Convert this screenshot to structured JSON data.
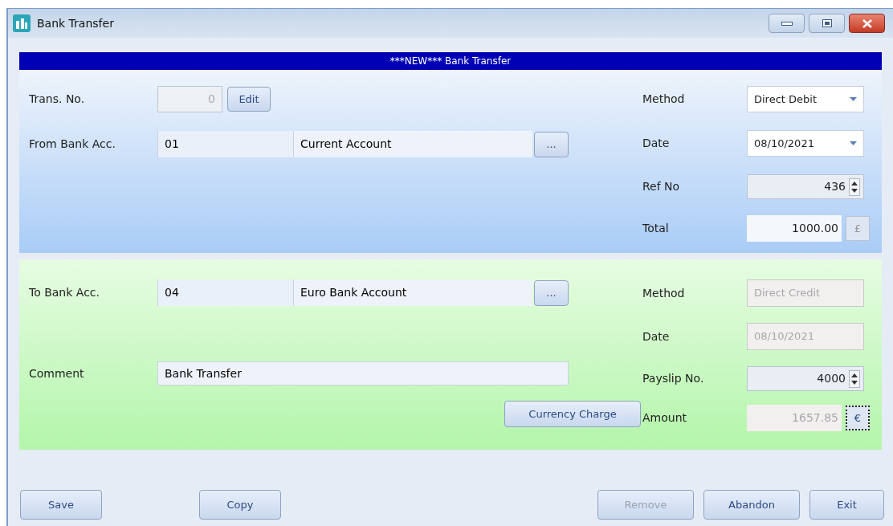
{
  "window": {
    "title": "Bank Transfer"
  },
  "banner": "***NEW*** Bank Transfer",
  "from_section": {
    "trans_no": {
      "label": "Trans. No.",
      "value": "0",
      "disabled": true
    },
    "edit_button": "Edit",
    "account": {
      "label": "From Bank Acc.",
      "code": "01",
      "name": "Current Account",
      "browse": "..."
    },
    "fields": [
      {
        "kind": "select",
        "label": "Method",
        "value": "Direct Debit",
        "disabled": false
      },
      {
        "kind": "select",
        "label": "Date",
        "value": "08/10/2021",
        "disabled": false
      },
      {
        "kind": "spin",
        "label": "Ref No",
        "value": "436",
        "disabled": false
      },
      {
        "kind": "money",
        "label": "Total",
        "value": "1000.00",
        "currency": "£",
        "disabled": false
      }
    ]
  },
  "to_section": {
    "account": {
      "label": "To Bank Acc.",
      "code": "04",
      "name": "Euro Bank Account",
      "browse": "..."
    },
    "comment": {
      "label": "Comment",
      "value": "Bank Transfer"
    },
    "currency_charge_button": "Currency Charge",
    "fields": [
      {
        "kind": "text",
        "label": "Method",
        "value": "Direct Credit",
        "disabled": true
      },
      {
        "kind": "text",
        "label": "Date",
        "value": "08/10/2021",
        "disabled": true
      },
      {
        "kind": "spin",
        "label": "Payslip No.",
        "value": "4000",
        "disabled": false
      },
      {
        "kind": "money",
        "label": "Amount",
        "value": "1657.85",
        "currency": "€",
        "disabled": true
      }
    ]
  },
  "buttons_left": [
    {
      "label": "Save",
      "disabled": false
    },
    {
      "label": "Copy",
      "disabled": false
    }
  ],
  "buttons_right": [
    {
      "label": "Remove",
      "disabled": true
    },
    {
      "label": "Abandon",
      "disabled": false
    },
    {
      "label": "Exit",
      "disabled": false
    }
  ]
}
